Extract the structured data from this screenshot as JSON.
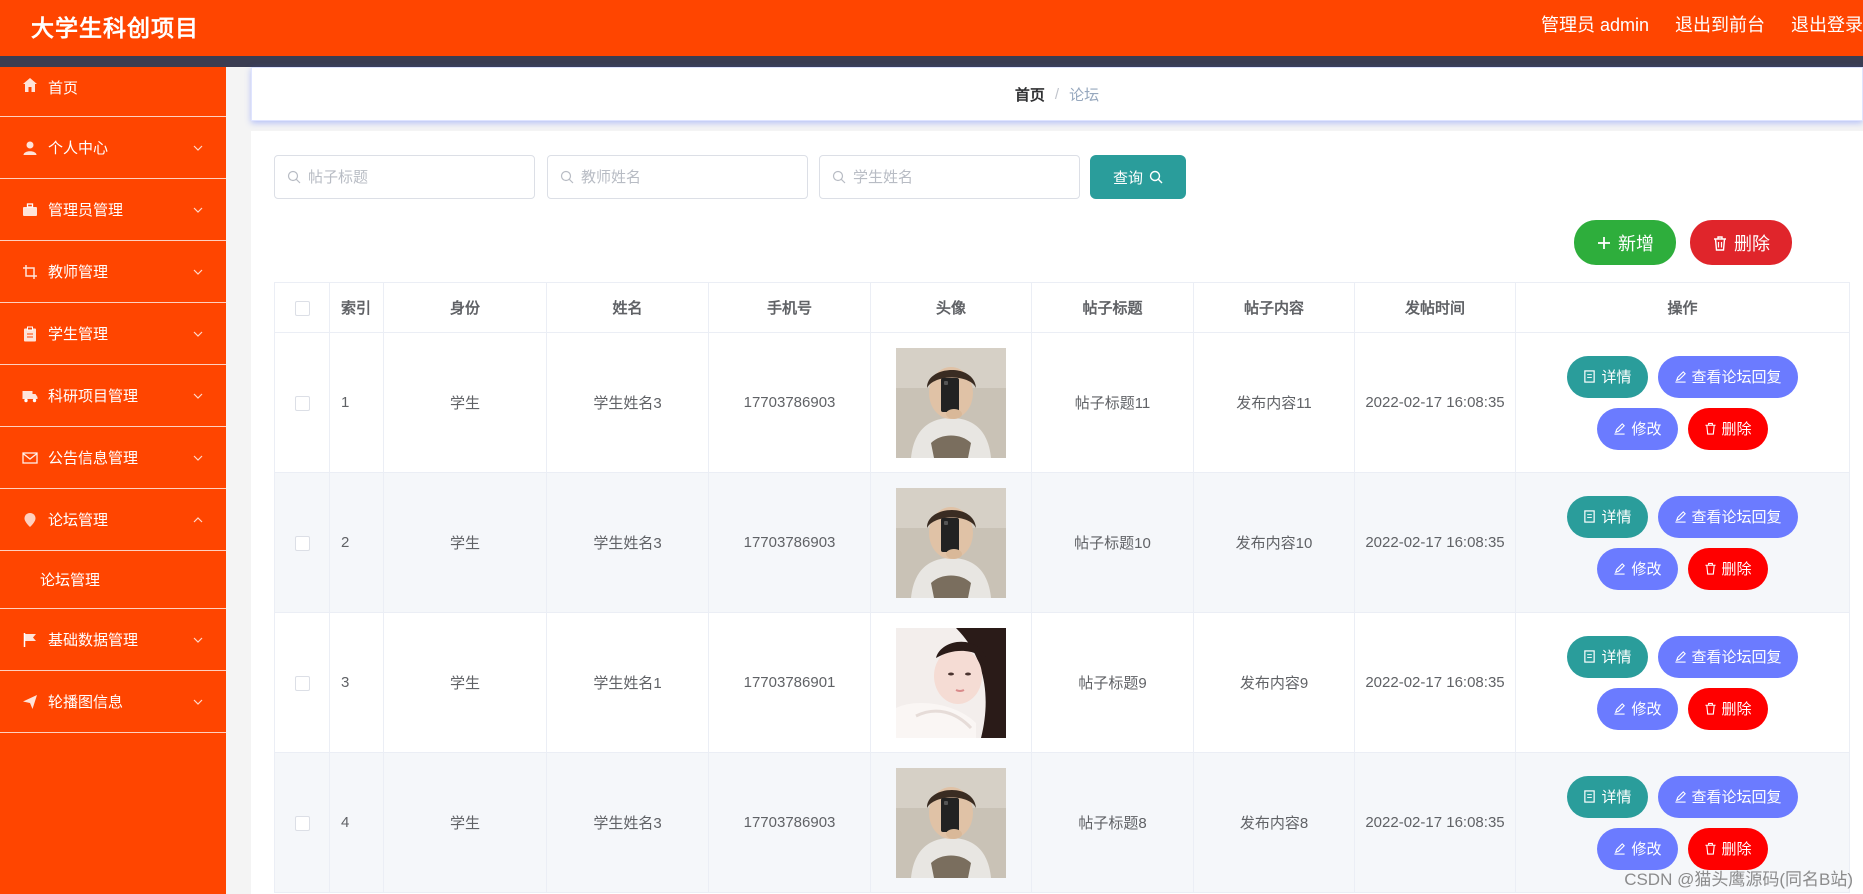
{
  "header": {
    "title": "大学生科创项目",
    "admin_label": "管理员 admin",
    "to_front": "退出到前台",
    "logout": "退出登录"
  },
  "sidebar": {
    "items": [
      {
        "label": "首页",
        "icon": "home-icon"
      },
      {
        "label": "个人中心",
        "icon": "user-icon"
      },
      {
        "label": "管理员管理",
        "icon": "briefcase-icon"
      },
      {
        "label": "教师管理",
        "icon": "crop-icon"
      },
      {
        "label": "学生管理",
        "icon": "clipboard-icon"
      },
      {
        "label": "科研项目管理",
        "icon": "truck-icon"
      },
      {
        "label": "公告信息管理",
        "icon": "mail-icon"
      },
      {
        "label": "论坛管理",
        "icon": "location-icon"
      },
      {
        "label": "基础数据管理",
        "icon": "flag-icon"
      },
      {
        "label": "轮播图信息",
        "icon": "send-icon"
      }
    ],
    "submenu_forum": "论坛管理"
  },
  "breadcrumb": {
    "home": "首页",
    "separator": "/",
    "current": "论坛"
  },
  "search": {
    "post_title_placeholder": "帖子标题",
    "teacher_name_placeholder": "教师姓名",
    "student_name_placeholder": "学生姓名",
    "query_label": "查询"
  },
  "actions": {
    "add_label": "新增",
    "delete_label": "删除"
  },
  "table": {
    "headers": [
      "索引",
      "身份",
      "姓名",
      "手机号",
      "头像",
      "帖子标题",
      "帖子内容",
      "发帖时间",
      "操作"
    ],
    "rows": [
      {
        "index": "1",
        "role": "学生",
        "name": "学生姓名3",
        "phone": "17703786903",
        "title": "帖子标题11",
        "content": "发布内容11",
        "time": "2022-02-17 16:08:35",
        "avatar": "male"
      },
      {
        "index": "2",
        "role": "学生",
        "name": "学生姓名3",
        "phone": "17703786903",
        "title": "帖子标题10",
        "content": "发布内容10",
        "time": "2022-02-17 16:08:35",
        "avatar": "male"
      },
      {
        "index": "3",
        "role": "学生",
        "name": "学生姓名1",
        "phone": "17703786901",
        "title": "帖子标题9",
        "content": "发布内容9",
        "time": "2022-02-17 16:08:35",
        "avatar": "female"
      },
      {
        "index": "4",
        "role": "学生",
        "name": "学生姓名3",
        "phone": "17703786903",
        "title": "帖子标题8",
        "content": "发布内容8",
        "time": "2022-02-17 16:08:35",
        "avatar": "male"
      }
    ],
    "op_labels": {
      "detail": "详情",
      "reply": "查看论坛回复",
      "edit": "修改",
      "delete": "删除"
    }
  },
  "watermark": "CSDN @猫头鹰源码(同名B站)",
  "colors": {
    "brand": "#ff4500",
    "teal": "#2a9d9b",
    "purple_blue": "#6b7bff",
    "red": "#ff0000",
    "green": "#2eae3c"
  }
}
